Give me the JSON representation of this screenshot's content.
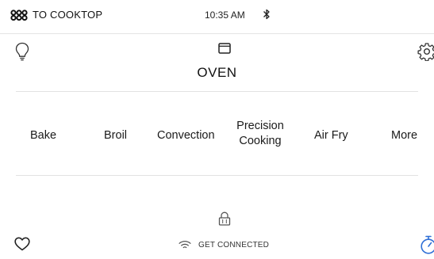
{
  "status_bar": {
    "cooktop_label": "TO COOKTOP",
    "time": "10:35 AM",
    "bluetooth_icon": "bluetooth-icon"
  },
  "header": {
    "title": "OVEN",
    "oven_icon": "oven-icon",
    "light_icon": "light-bulb-icon",
    "settings_icon": "gear-icon"
  },
  "modes": {
    "bake": "Bake",
    "broil": "Broil",
    "convection": "Convection",
    "precision_line1": "Precision",
    "precision_line2": "Cooking",
    "air_fry": "Air Fry",
    "more": "More"
  },
  "footer": {
    "connect_label": "GET CONNECTED",
    "favorites_icon": "heart-icon",
    "lock_icon": "lock-icon",
    "wifi_icon": "wifi-icon",
    "timer_icon": "timer-icon"
  },
  "colors": {
    "accent_blue": "#2f6fd6",
    "text": "#1a1a1a",
    "divider": "#e2e2e2"
  }
}
